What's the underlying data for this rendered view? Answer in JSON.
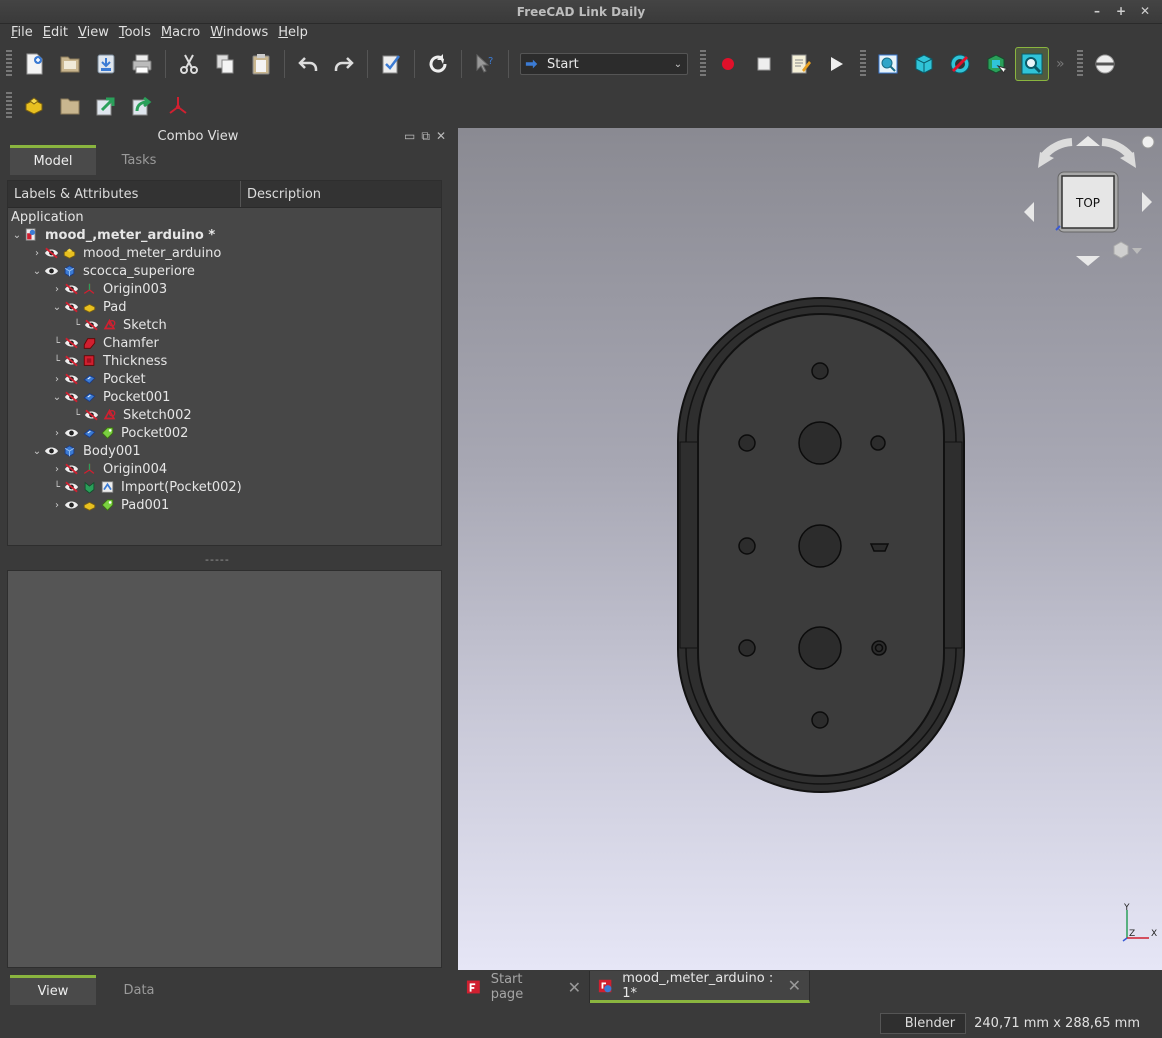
{
  "window": {
    "title": "FreeCAD Link Daily",
    "controls": [
      "minimize",
      "maximize",
      "close"
    ]
  },
  "menu": [
    "File",
    "Edit",
    "View",
    "Tools",
    "Macro",
    "Windows",
    "Help"
  ],
  "workbench": {
    "selected": "Start"
  },
  "combo_view": {
    "title": "Combo View",
    "tabs": [
      "Model",
      "Tasks"
    ],
    "active_tab": "Model",
    "columns": [
      "Labels & Attributes",
      "Description"
    ],
    "root_label": "Application",
    "tree": [
      {
        "label": "mood_,meter_arduino *",
        "level": 0,
        "expander": "open",
        "icon": "document-icon",
        "bold": true
      },
      {
        "label": "mood_meter_arduino",
        "level": 1,
        "expander": "closed",
        "icon": "part-icon",
        "hidden": true
      },
      {
        "label": "scocca_superiore",
        "level": 1,
        "expander": "open",
        "icon": "body-icon",
        "visible": true
      },
      {
        "label": "Origin003",
        "level": 2,
        "expander": "closed",
        "icon": "origin-icon",
        "hidden": true
      },
      {
        "label": "Pad",
        "level": 2,
        "expander": "open",
        "icon": "pad-icon",
        "hidden": true
      },
      {
        "label": "Sketch",
        "level": 3,
        "expander": "none",
        "icon": "sketch-icon",
        "hidden": true
      },
      {
        "label": "Chamfer",
        "level": 2,
        "expander": "none",
        "icon": "chamfer-icon",
        "hidden": true
      },
      {
        "label": "Thickness",
        "level": 2,
        "expander": "none",
        "icon": "thickness-icon",
        "hidden": true
      },
      {
        "label": "Pocket",
        "level": 2,
        "expander": "closed",
        "icon": "pocket-icon",
        "hidden": true
      },
      {
        "label": "Pocket001",
        "level": 2,
        "expander": "open",
        "icon": "pocket-icon",
        "hidden": true
      },
      {
        "label": "Sketch002",
        "level": 3,
        "expander": "none",
        "icon": "sketch-icon",
        "hidden": true
      },
      {
        "label": "Pocket002",
        "level": 2,
        "expander": "closed",
        "icon": "pocket-icon",
        "visible": true,
        "extra_icon": "tag-icon"
      },
      {
        "label": "Body001",
        "level": 1,
        "expander": "open",
        "icon": "body-icon",
        "visible": true
      },
      {
        "label": "Origin004",
        "level": 2,
        "expander": "closed",
        "icon": "origin-icon",
        "hidden": true
      },
      {
        "label": "Import(Pocket002)",
        "level": 2,
        "expander": "none",
        "icon": "import-icon",
        "hidden": true,
        "extra_icon": "binder-icon"
      },
      {
        "label": "Pad001",
        "level": 2,
        "expander": "closed",
        "icon": "pad-icon",
        "visible": true,
        "extra_icon": "tag-icon"
      }
    ],
    "bottom_tabs": [
      "View",
      "Data"
    ],
    "active_bottom_tab": "View"
  },
  "view3d": {
    "navcube_face": "TOP",
    "axes": {
      "x": "X",
      "y": "Y",
      "z": "Z"
    }
  },
  "doc_tabs": [
    {
      "label": "Start page",
      "active": false
    },
    {
      "label": "mood_,meter_arduino : 1*",
      "active": true
    }
  ],
  "status": {
    "navigation": "Blender",
    "dimensions": "240,71 mm x 288,65 mm"
  },
  "colors": {
    "accent": "#8ab53f",
    "panel": "#474747",
    "background": "#3a3a3a"
  }
}
